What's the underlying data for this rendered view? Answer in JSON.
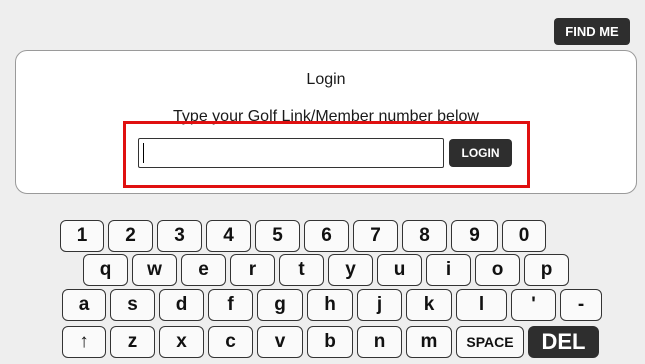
{
  "header": {
    "find_me_label": "FIND ME"
  },
  "login_panel": {
    "title": "Login",
    "instruction": "Type your Golf Link/Member number below",
    "input_value": "",
    "login_label": "LOGIN"
  },
  "keyboard": {
    "row1": [
      "1",
      "2",
      "3",
      "4",
      "5",
      "6",
      "7",
      "8",
      "9",
      "0"
    ],
    "row2": [
      "q",
      "w",
      "e",
      "r",
      "t",
      "y",
      "u",
      "i",
      "o",
      "p"
    ],
    "row3": [
      "a",
      "s",
      "d",
      "f",
      "g",
      "h",
      "j",
      "k",
      "l",
      "'",
      "-"
    ],
    "row4": [
      "↑",
      "z",
      "x",
      "c",
      "v",
      "b",
      "n",
      "m",
      "SPACE",
      "DEL"
    ]
  }
}
